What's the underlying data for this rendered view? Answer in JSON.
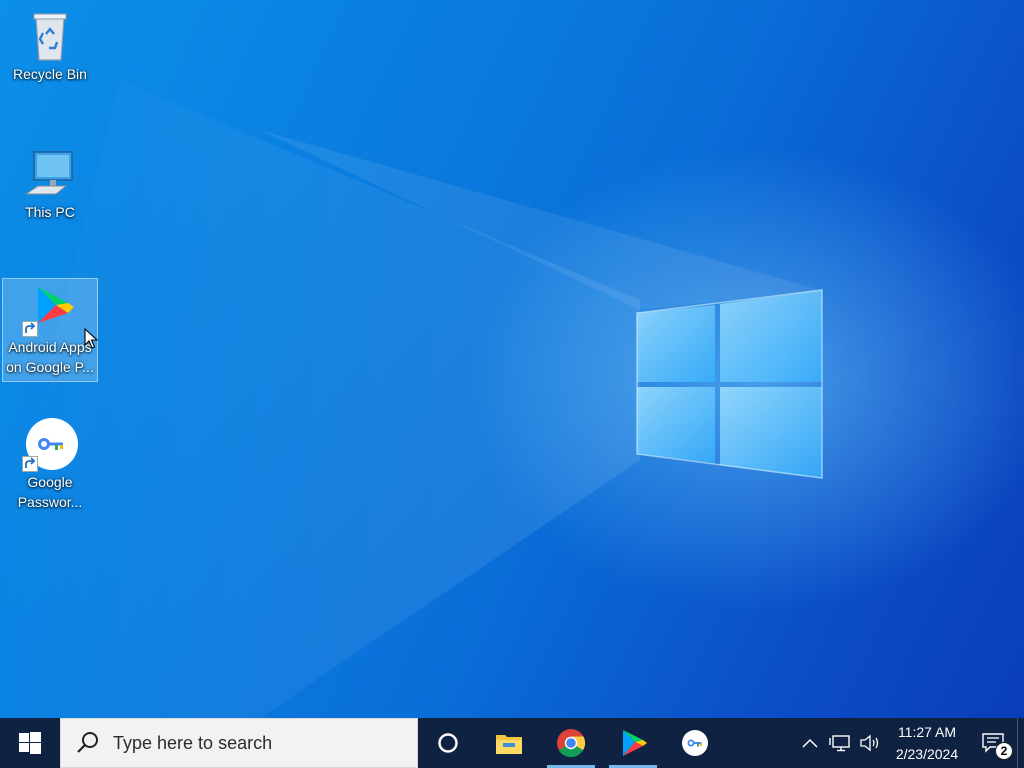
{
  "desktop": {
    "icons": [
      {
        "label": "Recycle Bin",
        "icon": "recycle-bin-icon"
      },
      {
        "label": "This PC",
        "icon": "computer-icon"
      },
      {
        "label": "Android Apps on Google P...",
        "icon": "google-play-icon",
        "selected": true
      },
      {
        "label": "Google Passwor...",
        "icon": "google-password-manager-icon"
      }
    ]
  },
  "taskbar": {
    "search": {
      "placeholder": "Type here to search"
    },
    "pinned": [
      {
        "name": "Cortana",
        "icon": "cortana-icon",
        "running": false
      },
      {
        "name": "File Explorer",
        "icon": "file-explorer-icon",
        "running": false
      },
      {
        "name": "Google Chrome",
        "icon": "chrome-icon",
        "running": true
      },
      {
        "name": "Google Play",
        "icon": "google-play-icon",
        "running": true
      },
      {
        "name": "Google Password Manager",
        "icon": "google-password-manager-icon",
        "running": false
      }
    ],
    "clock": {
      "time": "11:27 AM",
      "date": "2/23/2024"
    },
    "notifications": {
      "count": "2"
    }
  },
  "colors": {
    "taskbar": "#10203c",
    "accent": "#76b9ed",
    "wallpaper": "#0a6fd8"
  }
}
